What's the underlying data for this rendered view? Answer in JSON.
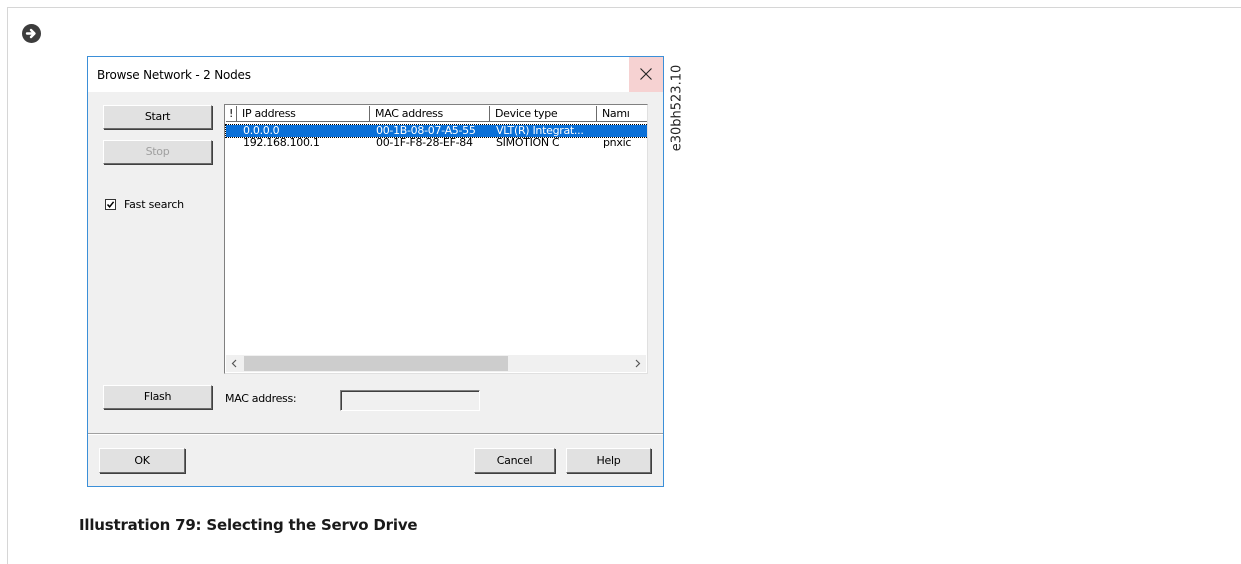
{
  "page": {
    "caption": "Illustration 79: Selecting the Servo Drive",
    "watermark": "e30bh523.10",
    "marker_icon": "arrow-circle-right-icon"
  },
  "dialog": {
    "title": "Browse Network - 2 Nodes",
    "close_icon": "close-icon",
    "buttons": {
      "start": "Start",
      "stop": "Stop",
      "flash": "Flash",
      "ok": "OK",
      "cancel": "Cancel",
      "help": "Help"
    },
    "fast_search": {
      "label": "Fast search",
      "checked": true
    },
    "mac_address_label": "MAC address:",
    "mac_address_value": "",
    "list": {
      "columns": [
        "!",
        "IP address",
        "MAC address",
        "Device type",
        "Name"
      ],
      "column_visible": [
        "!",
        "IP address",
        "MAC address",
        "Device type",
        "Namı"
      ],
      "rows": [
        {
          "flag": "",
          "ip": "0.0.0.0",
          "mac": "00-1B-08-07-A5-55",
          "device_type": "VLT(R) Integrat...",
          "name": "",
          "selected": true
        },
        {
          "flag": "",
          "ip": "192.168.100.1",
          "mac": "00-1F-F8-28-EF-84",
          "device_type": "SIMOTION C",
          "name": "pnxic",
          "selected": false
        }
      ],
      "scroll_left_icon": "chevron-left-icon",
      "scroll_right_icon": "chevron-right-icon"
    },
    "colors": {
      "selection": "#0a70d8",
      "border": "#3b8fd8",
      "close_hover": "#f6d2d2",
      "face": "#f0f0f0"
    }
  }
}
